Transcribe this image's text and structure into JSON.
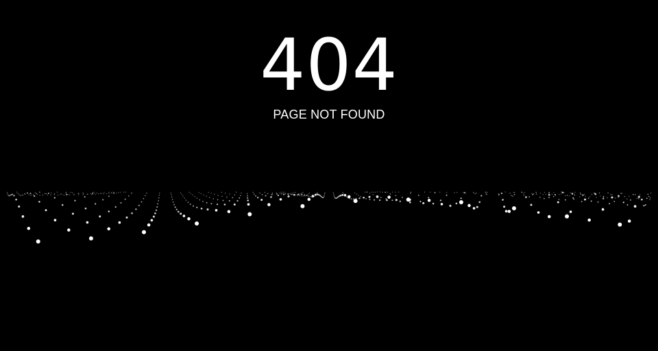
{
  "error": {
    "code": "404",
    "message": "PAGE NOT FOUND"
  },
  "colors": {
    "background": "#000000",
    "text": "#ffffff",
    "particles": "#ffffff"
  },
  "background_decoration": "particle-wave"
}
